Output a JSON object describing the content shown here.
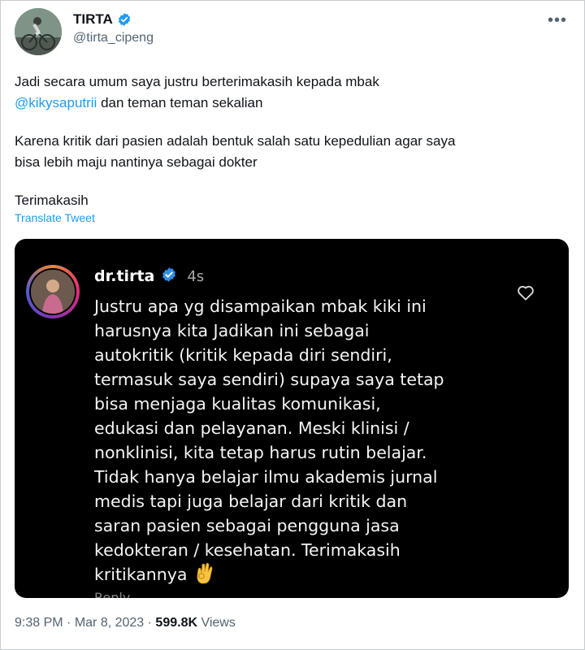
{
  "author": {
    "display_name": "TIRTA",
    "handle": "@tirta_cipeng",
    "verified": true
  },
  "tweet": {
    "paragraph1_before": "Jadi secara umum  saya justru berterimakasih kepada mbak",
    "mention": "@kikysaputrii",
    "paragraph1_after": " dan teman teman sekalian",
    "paragraph2_line1": "Karena kritik dari pasien adalah bentuk salah satu kepedulian agar saya",
    "paragraph2_line2": "bisa lebih maju nantinya sebagai dokter",
    "paragraph3": "Terimakasih",
    "translate_label": "Translate Tweet"
  },
  "embedded_comment": {
    "username": "dr.tirta",
    "time": "4s",
    "lines": [
      "Justru apa yg disampaikan mbak kiki ini",
      "harusnya kita Jadikan ini sebagai",
      "autokritik (kritik kepada diri sendiri,",
      "termasuk saya sendiri) supaya saya tetap",
      "bisa menjaga kualitas komunikasi,",
      "edukasi dan pelayanan. Meski klinisi /",
      "nonklinisi, kita tetap harus rutin belajar.",
      "Tidak hanya belajar ilmu akademis jurnal",
      "medis tapi juga belajar dari kritik dan",
      "saran pasien sebagai pengguna jasa",
      "kedokteran / kesehatan. Terimakasih",
      "kritikannya"
    ],
    "reply_label": "Reply"
  },
  "meta": {
    "time": "9:38 PM",
    "separator": " · ",
    "date": "Mar 8, 2023",
    "views_count": "599.8K",
    "views_label": " Views"
  },
  "colors": {
    "accent": "#1d9bf0",
    "text": "#0f1419",
    "secondary": "#536471"
  },
  "icons": [
    "verified-badge-icon",
    "more-icon",
    "heart-icon",
    "ok-hand-emoji-icon"
  ]
}
